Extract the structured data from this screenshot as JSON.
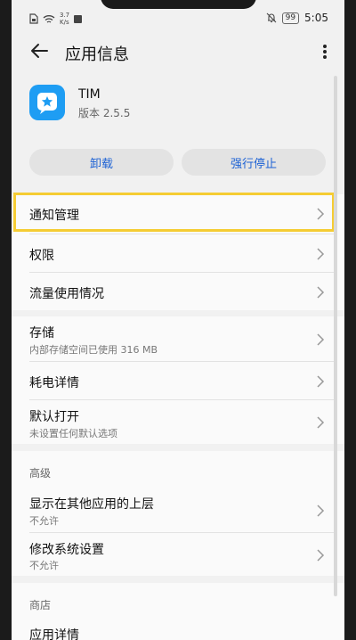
{
  "status_bar": {
    "net_speed_value": "3.7",
    "net_speed_unit": "K/s",
    "battery": "99",
    "time": "5:05"
  },
  "header": {
    "title": "应用信息"
  },
  "app": {
    "name": "TIM",
    "version": "版本 2.5.5"
  },
  "actions": {
    "uninstall": "卸载",
    "force_stop": "强行停止"
  },
  "menu": {
    "notifications": "通知管理",
    "permissions": "权限",
    "data_usage": "流量使用情况",
    "storage": {
      "label": "存储",
      "sub": "内部存储空间已使用 316 MB"
    },
    "battery": "耗电详情",
    "open_default": {
      "label": "默认打开",
      "sub": "未设置任何默认选项"
    }
  },
  "advanced": {
    "heading": "高级",
    "overlay": {
      "label": "显示在其他应用的上层",
      "sub": "不允许"
    },
    "modify_settings": {
      "label": "修改系统设置",
      "sub": "不允许"
    }
  },
  "store": {
    "heading": "商店",
    "row_partial": "应用详情"
  },
  "colors": {
    "accent": "#1d62d4",
    "highlight": "#f5cc33",
    "app_icon": "#1e9df3"
  }
}
